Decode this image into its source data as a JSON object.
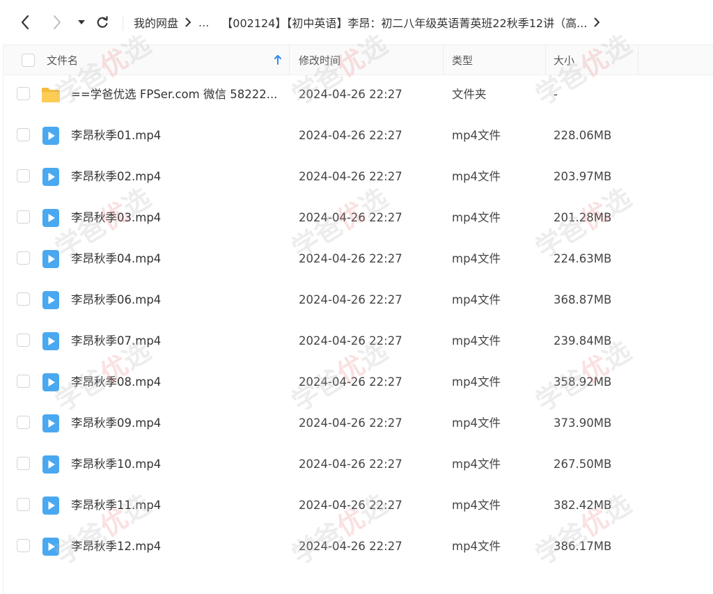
{
  "breadcrumb": {
    "root": "我的网盘",
    "ellipsis": "...",
    "current": "【002124】【初中英语】李昂：初二八年级英语菁英班22秋季12讲（高..."
  },
  "columns": {
    "name": "文件名",
    "modified": "修改时间",
    "type": "类型",
    "size": "大小"
  },
  "files": [
    {
      "name": "==学爸优选 FPSer.com 微信 58222...",
      "modified": "2024-04-26 22:27",
      "type": "文件夹",
      "size": "-",
      "icon": "folder-icon"
    },
    {
      "name": "李昂秋季01.mp4",
      "modified": "2024-04-26 22:27",
      "type": "mp4文件",
      "size": "228.06MB",
      "icon": "video-file-icon"
    },
    {
      "name": "李昂秋季02.mp4",
      "modified": "2024-04-26 22:27",
      "type": "mp4文件",
      "size": "203.97MB",
      "icon": "video-file-icon"
    },
    {
      "name": "李昂秋季03.mp4",
      "modified": "2024-04-26 22:27",
      "type": "mp4文件",
      "size": "201.28MB",
      "icon": "video-file-icon"
    },
    {
      "name": "李昂秋季04.mp4",
      "modified": "2024-04-26 22:27",
      "type": "mp4文件",
      "size": "224.63MB",
      "icon": "video-file-icon"
    },
    {
      "name": "李昂秋季06.mp4",
      "modified": "2024-04-26 22:27",
      "type": "mp4文件",
      "size": "368.87MB",
      "icon": "video-file-icon"
    },
    {
      "name": "李昂秋季07.mp4",
      "modified": "2024-04-26 22:27",
      "type": "mp4文件",
      "size": "239.84MB",
      "icon": "video-file-icon"
    },
    {
      "name": "李昂秋季08.mp4",
      "modified": "2024-04-26 22:27",
      "type": "mp4文件",
      "size": "358.92MB",
      "icon": "video-file-icon"
    },
    {
      "name": "李昂秋季09.mp4",
      "modified": "2024-04-26 22:27",
      "type": "mp4文件",
      "size": "373.90MB",
      "icon": "video-file-icon"
    },
    {
      "name": "李昂秋季10.mp4",
      "modified": "2024-04-26 22:27",
      "type": "mp4文件",
      "size": "267.50MB",
      "icon": "video-file-icon"
    },
    {
      "name": "李昂秋季11.mp4",
      "modified": "2024-04-26 22:27",
      "type": "mp4文件",
      "size": "382.42MB",
      "icon": "video-file-icon"
    },
    {
      "name": "李昂秋季12.mp4",
      "modified": "2024-04-26 22:27",
      "type": "mp4文件",
      "size": "386.17MB",
      "icon": "video-file-icon"
    }
  ],
  "watermark": {
    "text_a": "学爸",
    "text_b": "优",
    "text_c": "选"
  },
  "colors": {
    "accent": "#2d8cf0",
    "folder": "#f7c24b",
    "video": "#49a7ee"
  }
}
